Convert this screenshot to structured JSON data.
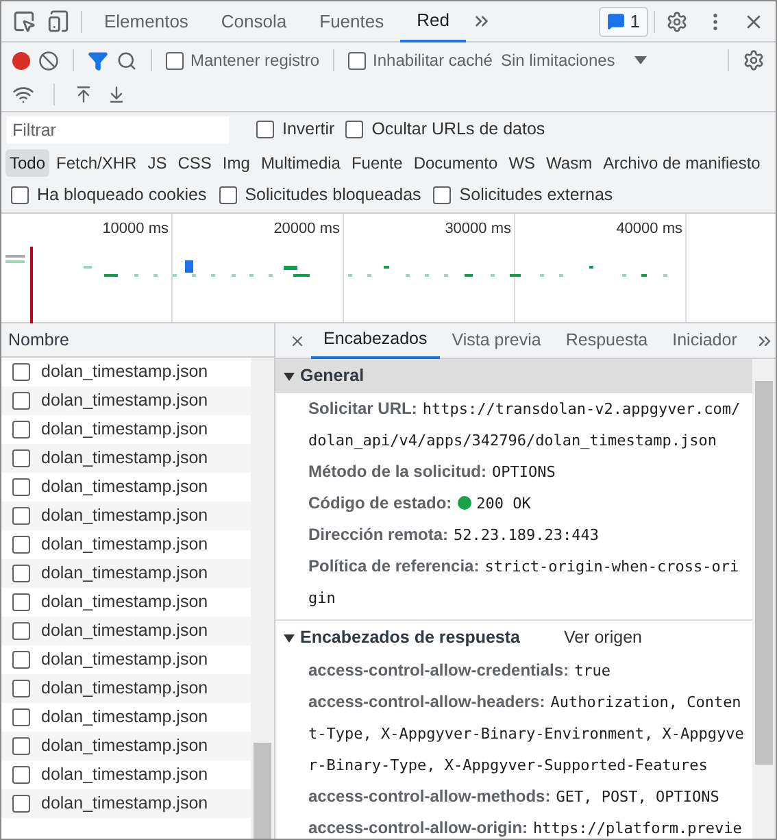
{
  "main_tabs": [
    {
      "label": "Elementos",
      "selected": false
    },
    {
      "label": "Consola",
      "selected": false
    },
    {
      "label": "Fuentes",
      "selected": false
    },
    {
      "label": "Red",
      "selected": true
    }
  ],
  "issues_badge": "1",
  "toolbar": {
    "recording": true,
    "checkboxes": [
      {
        "label": "Mantener registro",
        "checked": false
      },
      {
        "label": "Inhabilitar caché",
        "checked": false
      }
    ],
    "throttling": "Sin limitaciones"
  },
  "filter": {
    "placeholder": "Filtrar",
    "checkboxes": [
      {
        "label": "Invertir",
        "checked": false
      },
      {
        "label": "Ocultar URLs de datos",
        "checked": false
      }
    ]
  },
  "type_filters": [
    {
      "label": "Todo",
      "selected": true
    },
    {
      "label": "Fetch/XHR",
      "selected": false
    },
    {
      "label": "JS",
      "selected": false
    },
    {
      "label": "CSS",
      "selected": false
    },
    {
      "label": "Img",
      "selected": false
    },
    {
      "label": "Multimedia",
      "selected": false
    },
    {
      "label": "Fuente",
      "selected": false
    },
    {
      "label": "Documento",
      "selected": false
    },
    {
      "label": "WS",
      "selected": false
    },
    {
      "label": "Wasm",
      "selected": false
    },
    {
      "label": "Archivo de manifiesto",
      "selected": false
    }
  ],
  "extra_filters": [
    {
      "label": "Ha bloqueado cookies",
      "checked": false
    },
    {
      "label": "Solicitudes bloqueadas",
      "checked": false
    },
    {
      "label": "Solicitudes externas",
      "checked": false
    }
  ],
  "timeline": {
    "ticks": [
      "10000 ms",
      "20000 ms",
      "30000 ms",
      "40000 ms"
    ]
  },
  "requests": {
    "column": "Nombre",
    "rows": [
      {
        "name": "dolan_timestamp.json",
        "checked": false
      },
      {
        "name": "dolan_timestamp.json",
        "checked": false
      },
      {
        "name": "dolan_timestamp.json",
        "checked": false
      },
      {
        "name": "dolan_timestamp.json",
        "checked": false
      },
      {
        "name": "dolan_timestamp.json",
        "checked": false
      },
      {
        "name": "dolan_timestamp.json",
        "checked": false
      },
      {
        "name": "dolan_timestamp.json",
        "checked": false
      },
      {
        "name": "dolan_timestamp.json",
        "checked": false
      },
      {
        "name": "dolan_timestamp.json",
        "checked": false
      },
      {
        "name": "dolan_timestamp.json",
        "checked": false
      },
      {
        "name": "dolan_timestamp.json",
        "checked": false
      },
      {
        "name": "dolan_timestamp.json",
        "checked": false
      },
      {
        "name": "dolan_timestamp.json",
        "checked": false
      },
      {
        "name": "dolan_timestamp.json",
        "checked": false
      },
      {
        "name": "dolan_timestamp.json",
        "checked": false
      },
      {
        "name": "dolan_timestamp.json",
        "checked": false
      }
    ]
  },
  "detail_tabs": [
    {
      "label": "Encabezados",
      "selected": true
    },
    {
      "label": "Vista previa",
      "selected": false
    },
    {
      "label": "Respuesta",
      "selected": false
    },
    {
      "label": "Iniciador",
      "selected": false
    }
  ],
  "sections": [
    {
      "title": "General",
      "expanded": true,
      "highlighted": true,
      "fields": [
        {
          "name": "Solicitar URL:",
          "value": "https://transdolan-v2.appgyver.com/dolan_api/v4/apps/342796/dolan_timestamp.json"
        },
        {
          "name": "Método de la solicitud:",
          "value": "OPTIONS"
        },
        {
          "name": "Código de estado:",
          "value": "200 OK",
          "color": "#16a34a"
        },
        {
          "name": "Dirección remota:",
          "value": "52.23.189.23:443"
        },
        {
          "name": "Política de referencia:",
          "value": "strict-origin-when-cross-origin"
        }
      ]
    },
    {
      "title": "Encabezados de respuesta",
      "expanded": true,
      "highlighted": false,
      "link": "Ver origen",
      "fields": [
        {
          "name": "access-control-allow-credentials:",
          "value": "true"
        },
        {
          "name": "access-control-allow-headers:",
          "value": "Authorization, Content-Type, X-Appgyver-Binary-Environment, X-Appgyver-Binary-Type, X-Appgyver-Supported-Features"
        },
        {
          "name": "access-control-allow-methods:",
          "value": "GET, POST, OPTIONS"
        },
        {
          "name": "access-control-allow-origin:",
          "value": "https://platform.previe"
        }
      ]
    }
  ]
}
